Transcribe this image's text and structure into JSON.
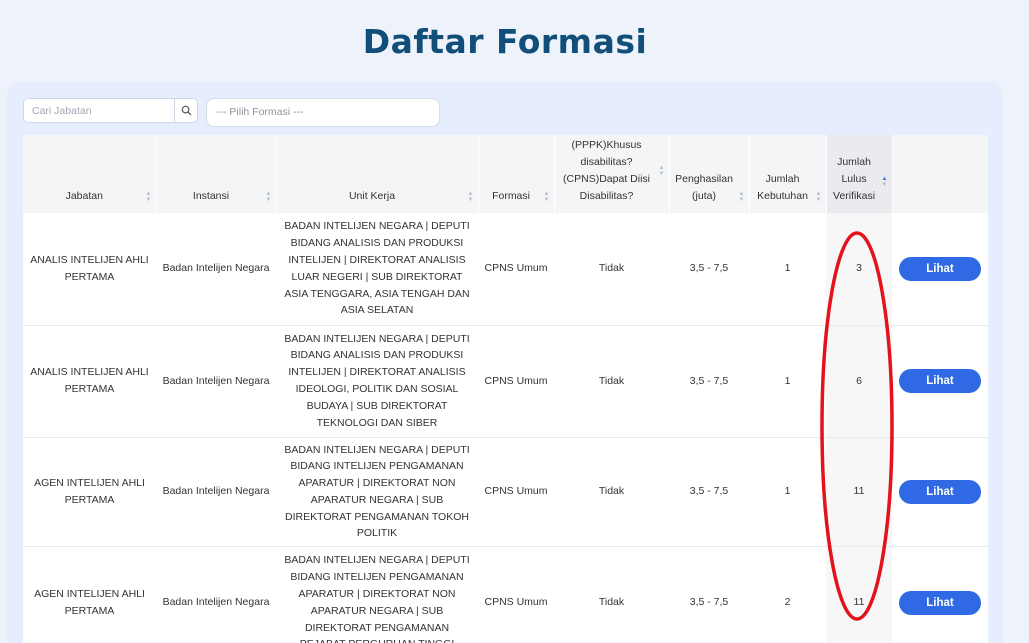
{
  "page": {
    "title": "Daftar Formasi"
  },
  "search": {
    "placeholder": "Cari Jabatan"
  },
  "formasi_select": {
    "value": "--- Pilih Formasi ---"
  },
  "columns": [
    "Jabatan",
    "Instansi",
    "Unit Kerja",
    "Formasi",
    "(PPPK)Khusus disabilitas? (CPNS)Dapat Diisi Disabilitas?",
    "Penghasilan (juta)",
    "Jumlah Kebutuhan",
    "Jumlah Lulus Verifikasi"
  ],
  "rows": [
    {
      "jabatan": "ANALIS INTELIJEN AHLI PERTAMA",
      "instansi": "Badan Intelijen Negara",
      "unit_kerja": "BADAN INTELIJEN NEGARA | DEPUTI BIDANG ANALISIS DAN PRODUKSI INTELIJEN | DIREKTORAT ANALISIS LUAR NEGERI | SUB DIREKTORAT ASIA TENGGARA, ASIA TENGAH DAN ASIA SELATAN",
      "formasi": "CPNS Umum",
      "disabilitas": "Tidak",
      "penghasilan": "3,5 - 7,5",
      "kebutuhan": "1",
      "lulus": "3",
      "action": "Lihat"
    },
    {
      "jabatan": "ANALIS INTELIJEN AHLI PERTAMA",
      "instansi": "Badan Intelijen Negara",
      "unit_kerja": "BADAN INTELIJEN NEGARA | DEPUTI BIDANG ANALISIS DAN PRODUKSI INTELIJEN | DIREKTORAT ANALISIS IDEOLOGI, POLITIK DAN SOSIAL BUDAYA | SUB DIREKTORAT TEKNOLOGI DAN SIBER",
      "formasi": "CPNS Umum",
      "disabilitas": "Tidak",
      "penghasilan": "3,5 - 7,5",
      "kebutuhan": "1",
      "lulus": "6",
      "action": "Lihat"
    },
    {
      "jabatan": "AGEN INTELIJEN AHLI PERTAMA",
      "instansi": "Badan Intelijen Negara",
      "unit_kerja": "BADAN INTELIJEN NEGARA | DEPUTI BIDANG INTELIJEN PENGAMANAN APARATUR | DIREKTORAT NON APARATUR NEGARA | SUB DIREKTORAT PENGAMANAN TOKOH POLITIK",
      "formasi": "CPNS Umum",
      "disabilitas": "Tidak",
      "penghasilan": "3,5 - 7,5",
      "kebutuhan": "1",
      "lulus": "11",
      "action": "Lihat"
    },
    {
      "jabatan": "AGEN INTELIJEN AHLI PERTAMA",
      "instansi": "Badan Intelijen Negara",
      "unit_kerja": "BADAN INTELIJEN NEGARA | DEPUTI BIDANG INTELIJEN PENGAMANAN APARATUR | DIREKTORAT NON APARATUR NEGARA | SUB DIREKTORAT PENGAMANAN PEJABAT PERGURUAN TINGGI",
      "formasi": "CPNS Umum",
      "disabilitas": "Tidak",
      "penghasilan": "3,5 - 7,5",
      "kebutuhan": "2",
      "lulus": "11",
      "action": "Lihat"
    }
  ],
  "colors": {
    "title": "#114e7a",
    "button": "#2f69e3",
    "highlight_ellipse": "#e3121b"
  }
}
